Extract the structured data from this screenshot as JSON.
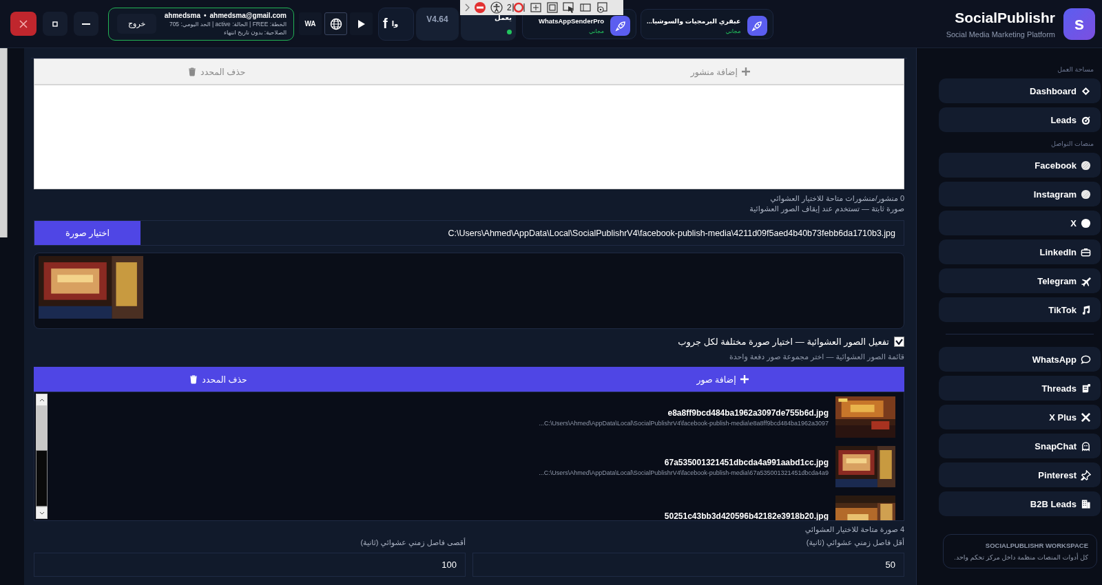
{
  "window_controls": {
    "close": true
  },
  "account": {
    "username": "ahmedsma",
    "separator": "•",
    "email": "ahmedsma@gmail.com",
    "plan_line": "الخطة: FREE  |  الحالة: active  |  الحد اليومي: 705",
    "validity": "الصلاحية: بدون تاريخ انتهاء",
    "logout": "خروج"
  },
  "tool_buttons": {
    "wa": "WA"
  },
  "app_tiles": [
    {
      "name": "عبقري البرمجيات والسوشيا...",
      "badge": "مجاني"
    },
    {
      "name": "WhatsAppSenderPro",
      "badge": "مجاني"
    }
  ],
  "partial_tiles": [
    {
      "text": "يعمل",
      "online": true
    },
    {
      "text": "V4.64"
    },
    {
      "icon_text": "f",
      "text": "وا"
    }
  ],
  "brand": {
    "logo_letter": "s",
    "title": "SocialPublishr",
    "subtitle": "Social Media Marketing Platform"
  },
  "overlay_toolbar": {
    "count": "2"
  },
  "posts_toolbar": {
    "add": "إضافة منشور",
    "delete": "حذف المحدد",
    "disabled": true
  },
  "posts_count": "0 منشور/منشورات متاحة للاختيار العشوائي",
  "fixed_image_hint": "صورة ثابتة — تستخدم عند إيقاف الصور العشوائية",
  "image_path": {
    "button": "اختيار صورة",
    "value": "C:\\Users\\Ahmed\\AppData\\Local\\SocialPublishrV4\\facebook-publish-media\\4211d09f5aed4b40b73febb6da1710b3.jpg"
  },
  "random_images": {
    "checked": true,
    "label": "تفعيل الصور العشوائية — اختيار صورة مختلفة لكل جروب"
  },
  "random_list_caption": "قائمة الصور العشوائية — اختر مجموعة صور دفعة واحدة",
  "images_toolbar": {
    "add": "إضافة صور",
    "delete": "حذف المحدد"
  },
  "images": [
    {
      "name": "e8a8ff9bcd484ba1962a3097de755b6d.jpg",
      "path": "C:\\Users\\Ahmed\\AppData\\Local\\SocialPublishrV4\\facebook-publish-media\\e8a8ff9bcd484ba1962a3097..."
    },
    {
      "name": "67a535001321451dbcda4a991aabd1cc.jpg",
      "path": "C:\\Users\\Ahmed\\AppData\\Local\\SocialPublishrV4\\facebook-publish-media\\67a535001321451dbcda4a9..."
    },
    {
      "name": "50251c43bb3d420596b42182e3918b20.jpg"
    }
  ],
  "images_count": "4 صورة متاحة للاختيار العشوائي",
  "intervals": [
    {
      "label": "أقل فاصل زمني عشوائي (ثانية)",
      "value": "50"
    },
    {
      "label": "أقصى فاصل زمني عشوائي (ثانية)",
      "value": "100"
    }
  ],
  "sidebar": {
    "sections": [
      {
        "title": "مساحة العمل",
        "items": [
          "Dashboard",
          "Leads"
        ]
      },
      {
        "title": "منصات التواصل",
        "items": [
          "Facebook",
          "Instagram",
          "X",
          "LinkedIn",
          "Telegram",
          "TikTok"
        ]
      },
      {
        "items": [
          "WhatsApp",
          "Threads",
          "X Plus",
          "SnapChat",
          "Pinterest",
          "B2B Leads"
        ]
      }
    ],
    "footer": {
      "title": "SOCIALPUBLISHR WORKSPACE",
      "text": "كل أدوات المنصات منظمة داخل مركز تحكم واحد."
    }
  }
}
